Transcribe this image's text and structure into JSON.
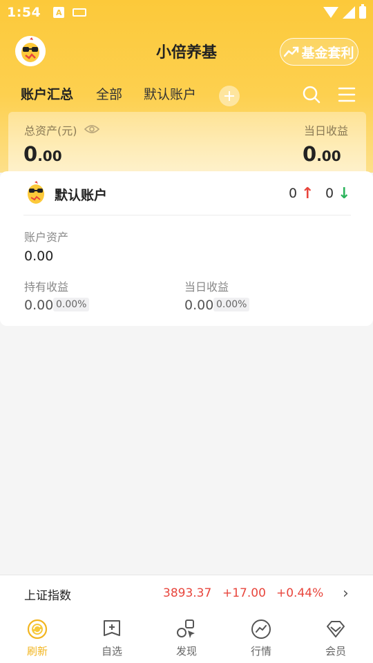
{
  "status_bar": {
    "time": "1:54",
    "a_badge": "A"
  },
  "header": {
    "title": "小倍养基",
    "arbitrage_button": "基金套利"
  },
  "tabs": [
    {
      "label": "账户汇总",
      "active": true
    },
    {
      "label": "全部",
      "active": false
    },
    {
      "label": "默认账户",
      "active": false
    }
  ],
  "summary": {
    "total_label": "总资产(元)",
    "total_int": "0",
    "total_dec": ".00",
    "daily_label": "当日收益",
    "daily_int": "0",
    "daily_dec": ".00"
  },
  "account": {
    "name": "默认账户",
    "up_count": "0",
    "down_count": "0",
    "up_arrow": "↑",
    "down_arrow": "↓",
    "assets_label": "账户资产",
    "assets_value": "0.00",
    "holding_label": "持有收益",
    "holding_value": "0.00",
    "holding_pct": "0.00%",
    "daily_label": "当日收益",
    "daily_value": "0.00",
    "daily_pct": "0.00%"
  },
  "index_bar": {
    "name": "上证指数",
    "value": "3893.37",
    "change": "+17.00",
    "change_pct": "+0.44%",
    "chevron": "›"
  },
  "bottom_nav": [
    {
      "label": "刷新",
      "icon": "refresh-icon",
      "active": true
    },
    {
      "label": "自选",
      "icon": "add-watchlist-icon",
      "active": false
    },
    {
      "label": "发现",
      "icon": "discover-icon",
      "active": false
    },
    {
      "label": "行情",
      "icon": "market-trend-icon",
      "active": false
    },
    {
      "label": "会员",
      "icon": "vip-diamond-icon",
      "active": false
    }
  ],
  "colors": {
    "brand_yellow": "#fcc93a",
    "up_red": "#e8453c",
    "down_green": "#2bb35b",
    "nav_active": "#f2b520"
  }
}
